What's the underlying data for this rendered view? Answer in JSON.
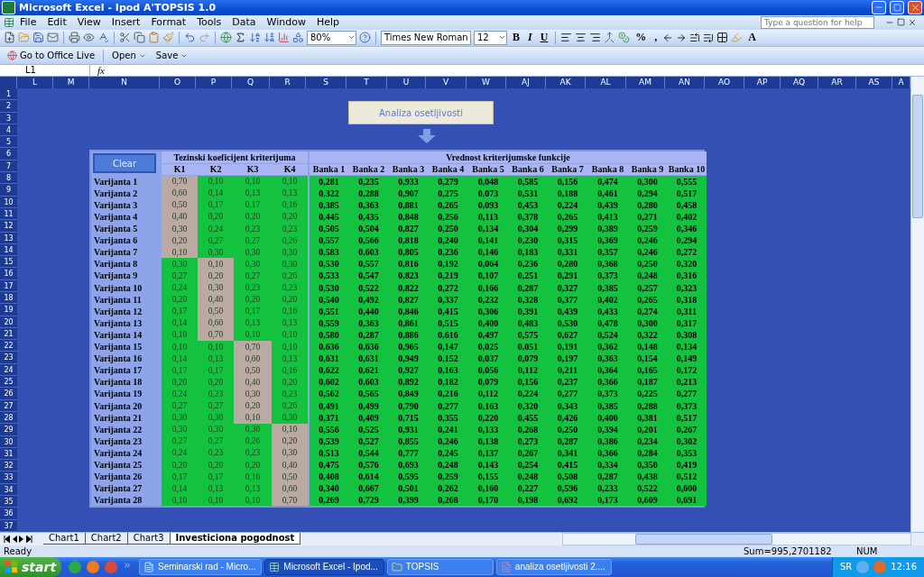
{
  "window": {
    "title": "Microsoft Excel - Ipod A'TOPSIS 1.0"
  },
  "menu": [
    "File",
    "Edit",
    "View",
    "Insert",
    "Format",
    "Tools",
    "Data",
    "Window",
    "Help"
  ],
  "help_search": {
    "placeholder": "Type a question for help"
  },
  "standard_toolbar": {
    "zoom": "80%"
  },
  "formatting_toolbar": {
    "font": "Times New Roman",
    "size": "12",
    "bold": "B",
    "italic": "I",
    "underline": "U",
    "percent": "%",
    "comma": ",",
    "font_color": "A"
  },
  "office_live_toolbar": {
    "office_live": "Go to Office Live",
    "open": "Open",
    "save": "Save"
  },
  "formula_bar": {
    "name_box": "L1",
    "fx": "fx"
  },
  "columns": [
    "L",
    "M",
    "N",
    "O",
    "P",
    "Q",
    "R",
    "S",
    "T",
    "U",
    "V",
    "W",
    "AJ",
    "AK",
    "AL",
    "AM",
    "AN",
    "AO",
    "AP",
    "AQ",
    "AR",
    "AS",
    "A"
  ],
  "row_numbers": [
    "1",
    "2",
    "3",
    "4",
    "5",
    "6",
    "7",
    "8",
    "9",
    "10",
    "11",
    "12",
    "13",
    "14",
    "15",
    "16",
    "17",
    "18",
    "19",
    "20",
    "21",
    "22",
    "23",
    "24",
    "25",
    "26",
    "27",
    "28",
    "29",
    "30",
    "31",
    "32",
    "33",
    "34",
    "35",
    "36",
    "37"
  ],
  "analysis_button": "Analiza osetljivosti",
  "table": {
    "clear_button": "Clear",
    "weights_title": "Tezinski koeficijent kriterijuma",
    "results_title": "Vrednost kriterijumske funkcije",
    "weight_columns": [
      "K1",
      "K2",
      "K3",
      "K4"
    ],
    "bank_columns": [
      "Banka 1",
      "Banka 2",
      "Banka 3",
      "Banka 4",
      "Banka 5",
      "Banka 6",
      "Banka 7",
      "Banka 8",
      "Banka 9",
      "Banka 10"
    ],
    "rows": [
      {
        "label": "Varijanta 1",
        "weights": [
          {
            "value": "0,70",
            "highlighted": true
          },
          {
            "value": "0,10",
            "highlighted": false
          },
          {
            "value": "0,10",
            "highlighted": false
          },
          {
            "value": "0,10",
            "highlighted": false
          }
        ],
        "banks": [
          "0,281",
          "0,235",
          "0,933",
          "0,279",
          "0,048",
          "0,585",
          "0,156",
          "0,474",
          "0,300",
          "0,555"
        ]
      },
      {
        "label": "Varijanta 2",
        "weights": [
          {
            "value": "0,60",
            "highlighted": true
          },
          {
            "value": "0,14",
            "highlighted": false
          },
          {
            "value": "0,13",
            "highlighted": false
          },
          {
            "value": "0,13",
            "highlighted": false
          }
        ],
        "banks": [
          "0,322",
          "0,288",
          "0,907",
          "0,275",
          "0,073",
          "0,531",
          "0,188",
          "0,461",
          "0,294",
          "0,517"
        ]
      },
      {
        "label": "Varijanta 3",
        "weights": [
          {
            "value": "0,50",
            "highlighted": true
          },
          {
            "value": "0,17",
            "highlighted": false
          },
          {
            "value": "0,17",
            "highlighted": false
          },
          {
            "value": "0,16",
            "highlighted": false
          }
        ],
        "banks": [
          "0,385",
          "0,363",
          "0,881",
          "0,265",
          "0,093",
          "0,453",
          "0,224",
          "0,439",
          "0,280",
          "0,458"
        ]
      },
      {
        "label": "Varijanta 4",
        "weights": [
          {
            "value": "0,40",
            "highlighted": true
          },
          {
            "value": "0,20",
            "highlighted": false
          },
          {
            "value": "0,20",
            "highlighted": false
          },
          {
            "value": "0,20",
            "highlighted": false
          }
        ],
        "banks": [
          "0,445",
          "0,435",
          "0,848",
          "0,256",
          "0,113",
          "0,378",
          "0,265",
          "0,413",
          "0,271",
          "0,402"
        ]
      },
      {
        "label": "Varijanta 5",
        "weights": [
          {
            "value": "0,30",
            "highlighted": true
          },
          {
            "value": "0,24",
            "highlighted": false
          },
          {
            "value": "0,23",
            "highlighted": false
          },
          {
            "value": "0,23",
            "highlighted": false
          }
        ],
        "banks": [
          "0,505",
          "0,504",
          "0,827",
          "0,250",
          "0,134",
          "0,304",
          "0,299",
          "0,389",
          "0,259",
          "0,346"
        ]
      },
      {
        "label": "Varijanta 6",
        "weights": [
          {
            "value": "0,20",
            "highlighted": true
          },
          {
            "value": "0,27",
            "highlighted": false
          },
          {
            "value": "0,27",
            "highlighted": false
          },
          {
            "value": "0,26",
            "highlighted": false
          }
        ],
        "banks": [
          "0,557",
          "0,566",
          "0,818",
          "0,240",
          "0,141",
          "0,230",
          "0,315",
          "0,369",
          "0,246",
          "0,294"
        ]
      },
      {
        "label": "Varijanta 7",
        "weights": [
          {
            "value": "0,10",
            "highlighted": true
          },
          {
            "value": "0,30",
            "highlighted": false
          },
          {
            "value": "0,30",
            "highlighted": false
          },
          {
            "value": "0,30",
            "highlighted": false
          }
        ],
        "banks": [
          "0,583",
          "0,603",
          "0,805",
          "0,236",
          "0,146",
          "0,183",
          "0,331",
          "0,357",
          "0,246",
          "0,272"
        ]
      },
      {
        "label": "Varijanta 8",
        "weights": [
          {
            "value": "0,30",
            "highlighted": false
          },
          {
            "value": "0,10",
            "highlighted": true
          },
          {
            "value": "0,30",
            "highlighted": false
          },
          {
            "value": "0,30",
            "highlighted": false
          }
        ],
        "banks": [
          "0,530",
          "0,557",
          "0,816",
          "0,192",
          "0,064",
          "0,236",
          "0,280",
          "0,368",
          "0,250",
          "0,320"
        ]
      },
      {
        "label": "Varijanta 9",
        "weights": [
          {
            "value": "0,27",
            "highlighted": false
          },
          {
            "value": "0,20",
            "highlighted": true
          },
          {
            "value": "0,27",
            "highlighted": false
          },
          {
            "value": "0,26",
            "highlighted": false
          }
        ],
        "banks": [
          "0,533",
          "0,547",
          "0,823",
          "0,219",
          "0,107",
          "0,251",
          "0,291",
          "0,373",
          "0,248",
          "0,316"
        ]
      },
      {
        "label": "Varijanta 10",
        "weights": [
          {
            "value": "0,24",
            "highlighted": false
          },
          {
            "value": "0,30",
            "highlighted": true
          },
          {
            "value": "0,23",
            "highlighted": false
          },
          {
            "value": "0,23",
            "highlighted": false
          }
        ],
        "banks": [
          "0,530",
          "0,522",
          "0,822",
          "0,272",
          "0,166",
          "0,287",
          "0,327",
          "0,385",
          "0,257",
          "0,323"
        ]
      },
      {
        "label": "Varijanta 11",
        "weights": [
          {
            "value": "0,20",
            "highlighted": false
          },
          {
            "value": "0,40",
            "highlighted": true
          },
          {
            "value": "0,20",
            "highlighted": false
          },
          {
            "value": "0,20",
            "highlighted": false
          }
        ],
        "banks": [
          "0,540",
          "0,492",
          "0,827",
          "0,337",
          "0,232",
          "0,328",
          "0,377",
          "0,402",
          "0,265",
          "0,318"
        ]
      },
      {
        "label": "Varijanta 12",
        "weights": [
          {
            "value": "0,17",
            "highlighted": false
          },
          {
            "value": "0,50",
            "highlighted": true
          },
          {
            "value": "0,17",
            "highlighted": false
          },
          {
            "value": "0,16",
            "highlighted": false
          }
        ],
        "banks": [
          "0,551",
          "0,440",
          "0,846",
          "0,415",
          "0,306",
          "0,391",
          "0,439",
          "0,433",
          "0,274",
          "0,311"
        ]
      },
      {
        "label": "Varijanta 13",
        "weights": [
          {
            "value": "0,14",
            "highlighted": false
          },
          {
            "value": "0,60",
            "highlighted": true
          },
          {
            "value": "0,13",
            "highlighted": false
          },
          {
            "value": "0,13",
            "highlighted": false
          }
        ],
        "banks": [
          "0,559",
          "0,363",
          "0,861",
          "0,515",
          "0,400",
          "0,483",
          "0,530",
          "0,478",
          "0,300",
          "0,317"
        ]
      },
      {
        "label": "Varijanta 14",
        "weights": [
          {
            "value": "0,10",
            "highlighted": false
          },
          {
            "value": "0,70",
            "highlighted": true
          },
          {
            "value": "0,10",
            "highlighted": false
          },
          {
            "value": "0,10",
            "highlighted": false
          }
        ],
        "banks": [
          "0,580",
          "0,287",
          "0,886",
          "0,616",
          "0,497",
          "0,575",
          "0,627",
          "0,524",
          "0,322",
          "0,308"
        ]
      },
      {
        "label": "Varijanta 15",
        "weights": [
          {
            "value": "0,10",
            "highlighted": false
          },
          {
            "value": "0,10",
            "highlighted": false
          },
          {
            "value": "0,70",
            "highlighted": true
          },
          {
            "value": "0,10",
            "highlighted": false
          }
        ],
        "banks": [
          "0,636",
          "0,636",
          "0,965",
          "0,147",
          "0,025",
          "0,051",
          "0,191",
          "0,362",
          "0,148",
          "0,134"
        ]
      },
      {
        "label": "Varijanta 16",
        "weights": [
          {
            "value": "0,14",
            "highlighted": false
          },
          {
            "value": "0,13",
            "highlighted": false
          },
          {
            "value": "0,60",
            "highlighted": true
          },
          {
            "value": "0,13",
            "highlighted": false
          }
        ],
        "banks": [
          "0,631",
          "0,631",
          "0,949",
          "0,152",
          "0,037",
          "0,079",
          "0,197",
          "0,363",
          "0,154",
          "0,149"
        ]
      },
      {
        "label": "Varijanta 17",
        "weights": [
          {
            "value": "0,17",
            "highlighted": false
          },
          {
            "value": "0,17",
            "highlighted": false
          },
          {
            "value": "0,50",
            "highlighted": true
          },
          {
            "value": "0,16",
            "highlighted": false
          }
        ],
        "banks": [
          "0,622",
          "0,621",
          "0,927",
          "0,163",
          "0,056",
          "0,112",
          "0,211",
          "0,364",
          "0,165",
          "0,172"
        ]
      },
      {
        "label": "Varijanta 18",
        "weights": [
          {
            "value": "0,20",
            "highlighted": false
          },
          {
            "value": "0,20",
            "highlighted": false
          },
          {
            "value": "0,40",
            "highlighted": true
          },
          {
            "value": "0,20",
            "highlighted": false
          }
        ],
        "banks": [
          "0,602",
          "0,603",
          "0,892",
          "0,182",
          "0,079",
          "0,156",
          "0,237",
          "0,366",
          "0,187",
          "0,213"
        ]
      },
      {
        "label": "Varijanta 19",
        "weights": [
          {
            "value": "0,24",
            "highlighted": false
          },
          {
            "value": "0,23",
            "highlighted": false
          },
          {
            "value": "0,30",
            "highlighted": true
          },
          {
            "value": "0,23",
            "highlighted": false
          }
        ],
        "banks": [
          "0,562",
          "0,565",
          "0,849",
          "0,216",
          "0,112",
          "0,224",
          "0,277",
          "0,373",
          "0,225",
          "0,277"
        ]
      },
      {
        "label": "Varijanta 20",
        "weights": [
          {
            "value": "0,27",
            "highlighted": false
          },
          {
            "value": "0,27",
            "highlighted": false
          },
          {
            "value": "0,20",
            "highlighted": true
          },
          {
            "value": "0,26",
            "highlighted": false
          }
        ],
        "banks": [
          "0,491",
          "0,499",
          "0,790",
          "0,277",
          "0,163",
          "0,320",
          "0,343",
          "0,385",
          "0,288",
          "0,373"
        ]
      },
      {
        "label": "Varijanta 21",
        "weights": [
          {
            "value": "0,30",
            "highlighted": false
          },
          {
            "value": "0,30",
            "highlighted": false
          },
          {
            "value": "0,10",
            "highlighted": true
          },
          {
            "value": "0,30",
            "highlighted": false
          }
        ],
        "banks": [
          "0,371",
          "0,409",
          "0,715",
          "0,355",
          "0,220",
          "0,455",
          "0,426",
          "0,400",
          "0,381",
          "0,517"
        ]
      },
      {
        "label": "Varijanta 22",
        "weights": [
          {
            "value": "0,30",
            "highlighted": false
          },
          {
            "value": "0,30",
            "highlighted": false
          },
          {
            "value": "0,30",
            "highlighted": false
          },
          {
            "value": "0,10",
            "highlighted": true
          }
        ],
        "banks": [
          "0,556",
          "0,525",
          "0,931",
          "0,241",
          "0,133",
          "0,268",
          "0,250",
          "0,394",
          "0,201",
          "0,267"
        ]
      },
      {
        "label": "Varijanta 23",
        "weights": [
          {
            "value": "0,27",
            "highlighted": false
          },
          {
            "value": "0,27",
            "highlighted": false
          },
          {
            "value": "0,26",
            "highlighted": false
          },
          {
            "value": "0,20",
            "highlighted": true
          }
        ],
        "banks": [
          "0,539",
          "0,527",
          "0,855",
          "0,246",
          "0,138",
          "0,273",
          "0,287",
          "0,386",
          "0,234",
          "0,302"
        ]
      },
      {
        "label": "Varijanta 24",
        "weights": [
          {
            "value": "0,24",
            "highlighted": false
          },
          {
            "value": "0,23",
            "highlighted": false
          },
          {
            "value": "0,23",
            "highlighted": false
          },
          {
            "value": "0,30",
            "highlighted": true
          }
        ],
        "banks": [
          "0,513",
          "0,544",
          "0,777",
          "0,245",
          "0,137",
          "0,267",
          "0,341",
          "0,366",
          "0,284",
          "0,353"
        ]
      },
      {
        "label": "Varijanta 25",
        "weights": [
          {
            "value": "0,20",
            "highlighted": false
          },
          {
            "value": "0,20",
            "highlighted": false
          },
          {
            "value": "0,20",
            "highlighted": false
          },
          {
            "value": "0,40",
            "highlighted": true
          }
        ],
        "banks": [
          "0,475",
          "0,576",
          "0,693",
          "0,248",
          "0,143",
          "0,254",
          "0,415",
          "0,334",
          "0,350",
          "0,419"
        ]
      },
      {
        "label": "Varijanta 26",
        "weights": [
          {
            "value": "0,17",
            "highlighted": false
          },
          {
            "value": "0,17",
            "highlighted": false
          },
          {
            "value": "0,16",
            "highlighted": false
          },
          {
            "value": "0,50",
            "highlighted": true
          }
        ],
        "banks": [
          "0,408",
          "0,614",
          "0,595",
          "0,259",
          "0,155",
          "0,248",
          "0,508",
          "0,287",
          "0,438",
          "0,512"
        ]
      },
      {
        "label": "Varijanta 27",
        "weights": [
          {
            "value": "0,14",
            "highlighted": false
          },
          {
            "value": "0,13",
            "highlighted": false
          },
          {
            "value": "0,13",
            "highlighted": false
          },
          {
            "value": "0,60",
            "highlighted": true
          }
        ],
        "banks": [
          "0,340",
          "0,667",
          "0,501",
          "0,262",
          "0,160",
          "0,227",
          "0,596",
          "0,233",
          "0,522",
          "0,600"
        ]
      },
      {
        "label": "Varijanta 28",
        "weights": [
          {
            "value": "0,10",
            "highlighted": false
          },
          {
            "value": "0,10",
            "highlighted": false
          },
          {
            "value": "0,10",
            "highlighted": false
          },
          {
            "value": "0,70",
            "highlighted": true
          }
        ],
        "banks": [
          "0,269",
          "0,729",
          "0,399",
          "0,268",
          "0,170",
          "0,198",
          "0,692",
          "0,173",
          "0,609",
          "0,691"
        ]
      }
    ]
  },
  "sheet_tabs": [
    {
      "label": "Chart1",
      "selected": false
    },
    {
      "label": "Chart2",
      "selected": false
    },
    {
      "label": "Chart3",
      "selected": false
    },
    {
      "label": "Investiciona pogodnost",
      "selected": true
    }
  ],
  "status_bar": {
    "status": "Ready",
    "sum": "Sum=995,2701182",
    "num": "NUM"
  },
  "taskbar": {
    "start": "start",
    "tasks": [
      {
        "label": "Seminarski rad - Micro...",
        "kind": "document",
        "selected": false
      },
      {
        "label": "Microsoft Excel - Ipod...",
        "kind": "spreadsheet",
        "selected": true
      },
      {
        "label": "TOPSIS",
        "kind": "folder",
        "selected": false
      },
      {
        "label": "analiza osetljivosti 2....",
        "kind": "pdf",
        "selected": false
      }
    ],
    "language": "SR",
    "clock": "12:16"
  }
}
